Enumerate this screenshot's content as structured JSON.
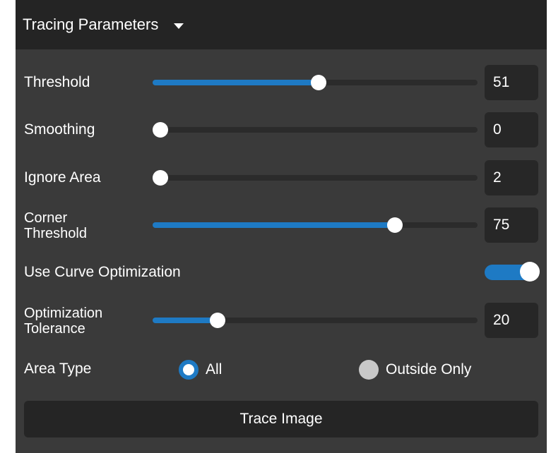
{
  "panel": {
    "title": "Tracing Parameters"
  },
  "params": [
    {
      "id": "threshold",
      "label_lines": [
        "Threshold"
      ],
      "value": "51",
      "fill_fraction": 0.51
    },
    {
      "id": "smoothing",
      "label_lines": [
        "Smoothing"
      ],
      "value": "0",
      "fill_fraction": 0.0
    },
    {
      "id": "ignore-area",
      "label_lines": [
        "Ignore Area"
      ],
      "value": "2",
      "fill_fraction": 0.02
    },
    {
      "id": "corner-threshold",
      "label_lines": [
        "Corner",
        "Threshold"
      ],
      "value": "75",
      "fill_fraction": 0.745
    },
    {
      "id": "optimization-tolerance",
      "label_lines": [
        "Optimization",
        "Tolerance"
      ],
      "value": "20",
      "fill_fraction": 0.2
    }
  ],
  "curve_optimization": {
    "label": "Use Curve Optimization",
    "enabled": true
  },
  "area_type": {
    "label": "Area Type",
    "options": [
      {
        "label": "All",
        "selected": true
      },
      {
        "label": "Outside Only",
        "selected": false
      }
    ]
  },
  "trace_button": {
    "label": "Trace Image"
  },
  "colors": {
    "accent": "#1e7ac4",
    "panel_bg": "#3a3a3a",
    "header_bg": "#242424"
  }
}
